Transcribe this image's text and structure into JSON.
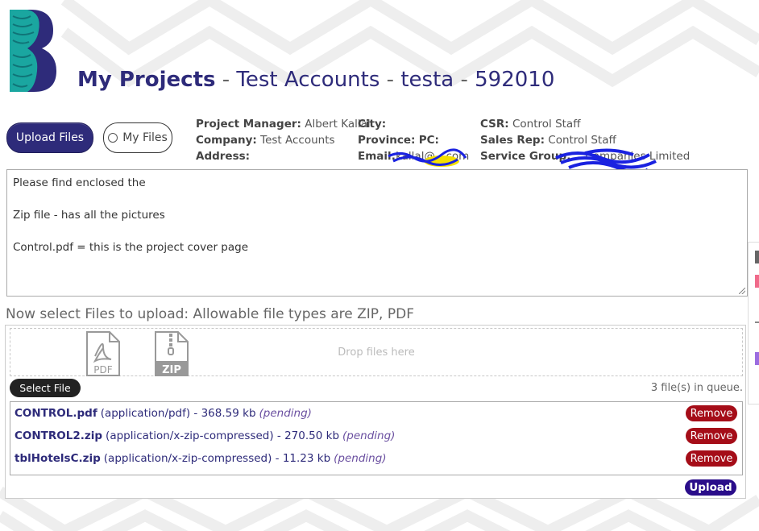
{
  "header": {
    "title_bold": "My Projects",
    "separator": " - ",
    "company": "Test Accounts",
    "user": "testa",
    "project_no": "592010"
  },
  "actions": {
    "upload_files_label": "Upload Files",
    "my_files_label": "My Files"
  },
  "project_info": {
    "project_manager_label": "Project Manager:",
    "project_manager_value": "Albert Kallal",
    "company_label": "Company:",
    "company_value": "Test Accounts",
    "address_label": "Address:",
    "address_value": "",
    "city_label": "City:",
    "city_value": "",
    "province_label": "Province:",
    "pc_label": "PC:",
    "email_label": "Email:",
    "email_value": "kallal@…com",
    "csr_label": "CSR:",
    "csr_value": "Control Staff",
    "sales_rep_label": "Sales Rep:",
    "sales_rep_value": "Control Staff",
    "service_group_label": "Service Group:",
    "service_group_value": "…Companies Limited"
  },
  "message": {
    "line1": "Please find enclosed the",
    "line2": "Zip file - has all the pictures",
    "line3": "Control.pdf = this is the project cover page"
  },
  "upload": {
    "instructions": "Now select Files to upload: Allowable file types are ZIP, PDF",
    "drop_text": "Drop files here",
    "select_file_label": "Select File",
    "queue_count": "3 file(s) in queue.",
    "upload_label": "Upload",
    "pdf_icon_label": "PDF",
    "zip_icon_label": "ZIP",
    "files": [
      {
        "name": "CONTROL.pdf",
        "meta": "(application/pdf) - 368.59 kb",
        "status": "(pending)",
        "remove_label": "Remove"
      },
      {
        "name": "CONTROL2.zip",
        "meta": "(application/x-zip-compressed) - 270.50 kb",
        "status": "(pending)",
        "remove_label": "Remove"
      },
      {
        "name": "tblHotelsC.zip",
        "meta": "(application/x-zip-compressed) - 11.23 kb",
        "status": "(pending)",
        "remove_label": "Remove"
      }
    ]
  },
  "colors": {
    "brand_navy": "#2e2b7a",
    "logo_teal": "#1aa6a0",
    "remove_red": "#a50d18",
    "upload_purple": "#2a0d8a"
  }
}
